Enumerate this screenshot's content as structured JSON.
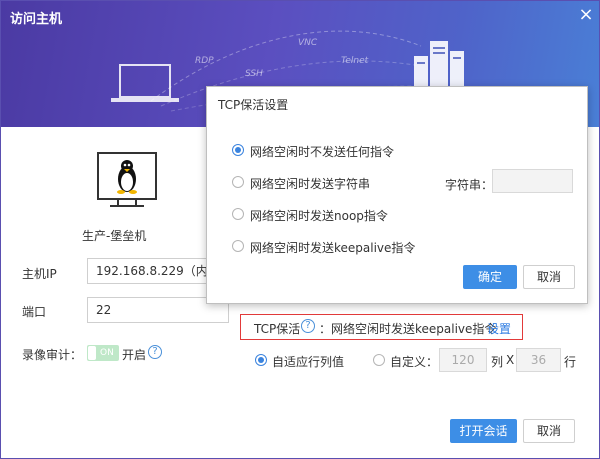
{
  "window": {
    "title": "访问主机",
    "close_symbol": "×"
  },
  "banner": {
    "protocols": [
      "RDP",
      "VNC",
      "SSH",
      "Telnet"
    ]
  },
  "host": {
    "name": "生产-堡垒机"
  },
  "form": {
    "ip_label": "主机IP",
    "ip_value": "192.168.8.229（内）",
    "port_label": "端口",
    "port_value": "22",
    "record_label": "录像审计：",
    "record_toggle_text": "ON",
    "record_state": "开启"
  },
  "tcp": {
    "label": "TCP保活",
    "help": "?",
    "description": "：网络空闲时发送keepalive指令",
    "link": "设置"
  },
  "resolution": {
    "auto_label": "自适应行列值",
    "custom_label": "自定义：",
    "cols_value": "120",
    "cols_unit": "列",
    "times": "X",
    "rows_value": "36",
    "rows_unit": "行"
  },
  "footer": {
    "open_label": "打开会话",
    "cancel_label": "取消"
  },
  "dialog": {
    "title": "TCP保活设置",
    "options": [
      "网络空闲时不发送任何指令",
      "网络空闲时发送字符串",
      "网络空闲时发送noop指令",
      "网络空闲时发送keepalive指令"
    ],
    "selected_index": 0,
    "string_label": "字符串：",
    "ok_label": "确定",
    "cancel_label": "取消"
  },
  "colors": {
    "accent": "#3d8ee6",
    "banner": "#5b4fc0",
    "highlight_border": "#e23a3a"
  }
}
